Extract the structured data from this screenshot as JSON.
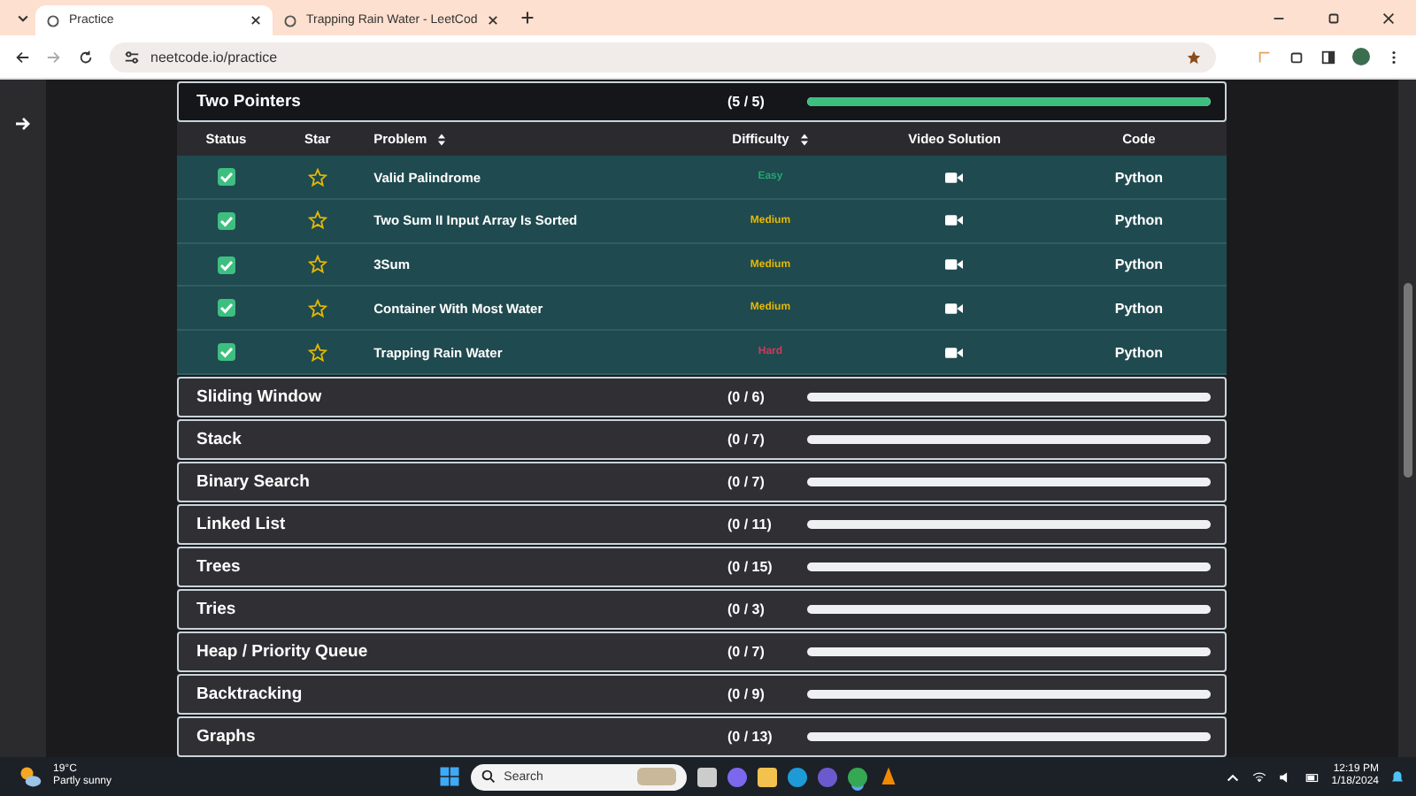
{
  "browser": {
    "tabs": [
      {
        "title": "Practice",
        "selected": true
      },
      {
        "title": "Trapping Rain Water - LeetCod",
        "selected": false
      }
    ],
    "address": "neetcode.io/practice"
  },
  "expanded_section": {
    "title": "Two Pointers",
    "count": "(5 / 5)",
    "level": 1,
    "columns": [
      "Status",
      "Star",
      "Problem",
      "Difficulty",
      "Video Solution",
      "Code"
    ],
    "rows": [
      {
        "checked": true,
        "problem": "Valid Palindrome",
        "difficulty": "Easy",
        "color": "#1fa971",
        "code": "Python"
      },
      {
        "checked": true,
        "problem": "Two Sum II Input Array Is Sorted",
        "difficulty": "Medium",
        "color": "#e6b800",
        "code": "Python"
      },
      {
        "checked": true,
        "problem": "3Sum",
        "difficulty": "Medium",
        "color": "#e6b800",
        "code": "Python"
      },
      {
        "checked": true,
        "problem": "Container With Most Water",
        "difficulty": "Medium",
        "color": "#e6b800",
        "code": "Python"
      },
      {
        "checked": true,
        "problem": "Trapping Rain Water",
        "difficulty": "Hard",
        "color": "#d03a5e",
        "code": "Python"
      }
    ]
  },
  "sections": [
    {
      "title": "Sliding Window",
      "count": "(0 / 6)",
      "level": 0
    },
    {
      "title": "Stack",
      "count": "(0 / 7)",
      "level": 0
    },
    {
      "title": "Binary Search",
      "count": "(0 / 7)",
      "level": 0
    },
    {
      "title": "Linked List",
      "count": "(0 / 11)",
      "level": 0
    },
    {
      "title": "Trees",
      "count": "(0 / 15)",
      "level": 0
    },
    {
      "title": "Tries",
      "count": "(0 / 3)",
      "level": 0
    },
    {
      "title": "Heap / Priority Queue",
      "count": "(0 / 7)",
      "level": 0
    },
    {
      "title": "Backtracking",
      "count": "(0 / 9)",
      "level": 0
    },
    {
      "title": "Graphs",
      "count": "(0 / 13)",
      "level": 0
    }
  ],
  "taskbar": {
    "temperature": "19°C",
    "weather": "Partly sunny",
    "search_placeholder": "Search",
    "time": "12:19 PM",
    "date": "1/18/2024"
  }
}
